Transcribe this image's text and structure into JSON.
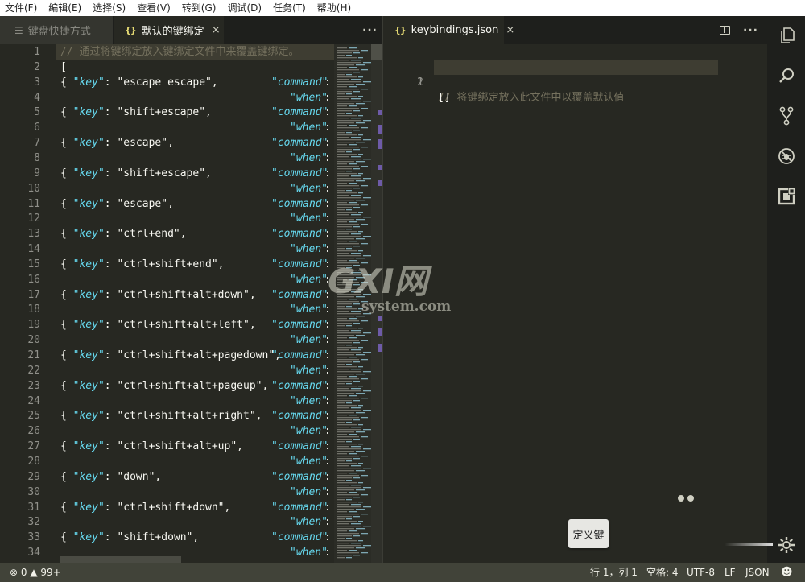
{
  "menu": [
    "文件(F)",
    "编辑(E)",
    "选择(S)",
    "查看(V)",
    "转到(G)",
    "调试(D)",
    "任务(T)",
    "帮助(H)"
  ],
  "left_tabs": [
    {
      "label": "键盘快捷方式",
      "icon": "list-icon",
      "active": false
    },
    {
      "label": "默认的键绑定",
      "icon": "json-braces-icon",
      "active": true
    }
  ],
  "right_tab": {
    "label": "keybindings.json",
    "icon": "json-braces-icon"
  },
  "json_icon_text": "{}",
  "close_glyph": "×",
  "more_glyph": "···",
  "left_editor": {
    "comment": "// 通过将键绑定放入键绑定文件中来覆盖键绑定。",
    "open_bracket": "[",
    "key_label": "\"key\"",
    "command_label": "\"command\"",
    "when_label": "\"when\"",
    "keys": [
      "escape escape",
      "shift+escape",
      "escape",
      "shift+escape",
      "escape",
      "ctrl+end",
      "ctrl+shift+end",
      "ctrl+shift+alt+down",
      "ctrl+shift+alt+left",
      "ctrl+shift+alt+pagedown",
      "ctrl+shift+alt+pageup",
      "ctrl+shift+alt+right",
      "ctrl+shift+alt+up",
      "down",
      "ctrl+shift+down",
      "shift+down"
    ],
    "line_count": 34
  },
  "right_editor": {
    "lines": [
      "// 将键绑定放入此文件中以覆盖默认值",
      "[]"
    ]
  },
  "activity_icons": [
    "explorer-icon",
    "search-icon",
    "source-control-icon",
    "debug-icon",
    "extensions-icon",
    "settings-gear-icon"
  ],
  "toast": {
    "text": "定义键"
  },
  "watermark": {
    "logo_text": "GXI网",
    "domain_text": "system.com"
  },
  "status": {
    "errors": "0",
    "warnings": "99+",
    "cursor": "行 1，列 1",
    "indent": "空格: 4",
    "encoding": "UTF-8",
    "eol": "LF",
    "language": "JSON"
  },
  "colors": {
    "editor_bg": "#272822",
    "keyword": "#66d9ef",
    "comment": "#75715e",
    "json_icon": "#e6db74",
    "statusbar": "#414339"
  }
}
